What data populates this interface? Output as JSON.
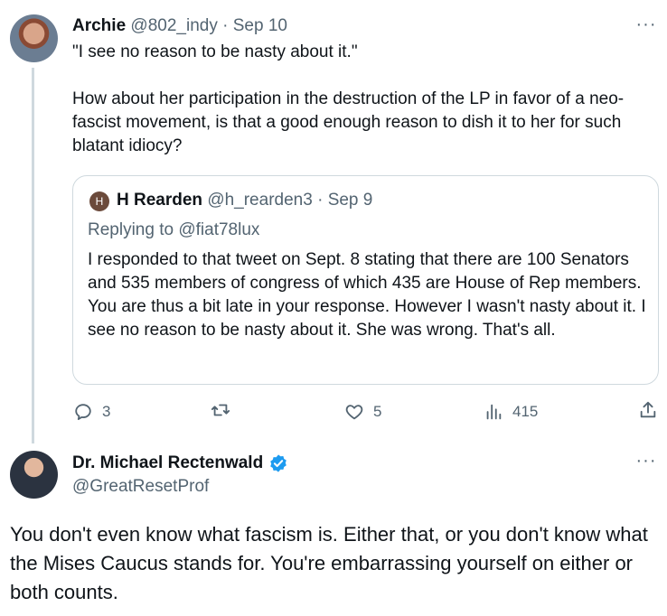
{
  "reply_tweet": {
    "author_name": "Archie",
    "author_handle": "@802_indy",
    "separator": "·",
    "date": "Sep 10",
    "more": "···",
    "text": "\"I see no reason to be nasty about it.\"\n\nHow about her participation in the destruction of the LP in favor of a neo-fascist movement, is that a good enough reason to dish it to her for such blatant idiocy?",
    "quoted": {
      "avatar_letter": "H",
      "author_name": "H Rearden",
      "author_handle": "@h_rearden3",
      "separator": "·",
      "date": "Sep 9",
      "replying_prefix": "Replying to",
      "replying_handle": "@fiat78lux",
      "text": "I responded to that tweet on Sept. 8 stating that there are 100 Senators and 535 members of congress of which 435 are House of Rep members. You are thus a bit late in your response. However I wasn't nasty about it. I see no reason to be nasty about it. She was wrong. That's all."
    },
    "actions": {
      "replies": "3",
      "retweets": "",
      "likes": "5",
      "views": "415",
      "icons": [
        "reply-icon",
        "retweet-icon",
        "like-icon",
        "views-icon",
        "share-icon"
      ]
    }
  },
  "main_tweet": {
    "author_name": "Dr. Michael Rectenwald",
    "verified": true,
    "author_handle": "@GreatResetProf",
    "more": "···",
    "text": "You don't even know what fascism is. Either that, or you don't know what the Mises Caucus stands for. You're embarrassing yourself on either or both counts."
  },
  "colors": {
    "text": "#0f1419",
    "muted": "#536471",
    "border": "#cfd9de",
    "verified": "#1d9bf0"
  }
}
